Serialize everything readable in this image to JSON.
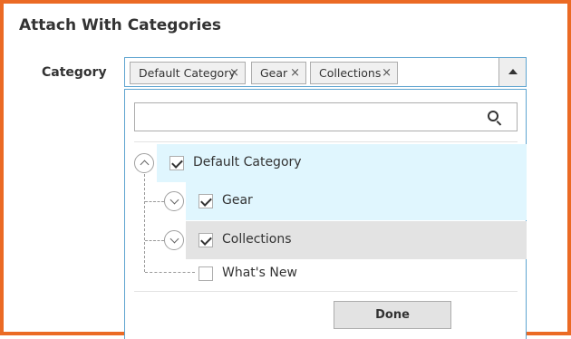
{
  "section": {
    "title": "Attach With Categories"
  },
  "field": {
    "label": "Category"
  },
  "chips": [
    {
      "label": "Default Category",
      "remove": "×"
    },
    {
      "label": "Gear",
      "remove": "×"
    },
    {
      "label": "Collections",
      "remove": "×"
    }
  ],
  "search": {
    "value": "",
    "placeholder": ""
  },
  "tree": {
    "items": [
      {
        "label": "Default Category",
        "checked": true,
        "expanded": true,
        "level": 0
      },
      {
        "label": "Gear",
        "checked": true,
        "expanded": false,
        "level": 1
      },
      {
        "label": "Collections",
        "checked": true,
        "expanded": false,
        "level": 1
      },
      {
        "label": "What's New",
        "checked": false,
        "level": 1
      }
    ]
  },
  "footer": {
    "done_label": "Done"
  },
  "colors": {
    "frame_border": "#eb6a24",
    "focus_border": "#5ea4d0",
    "selected_row": "#e0f6fe",
    "hover_row": "#e3e3e3"
  }
}
